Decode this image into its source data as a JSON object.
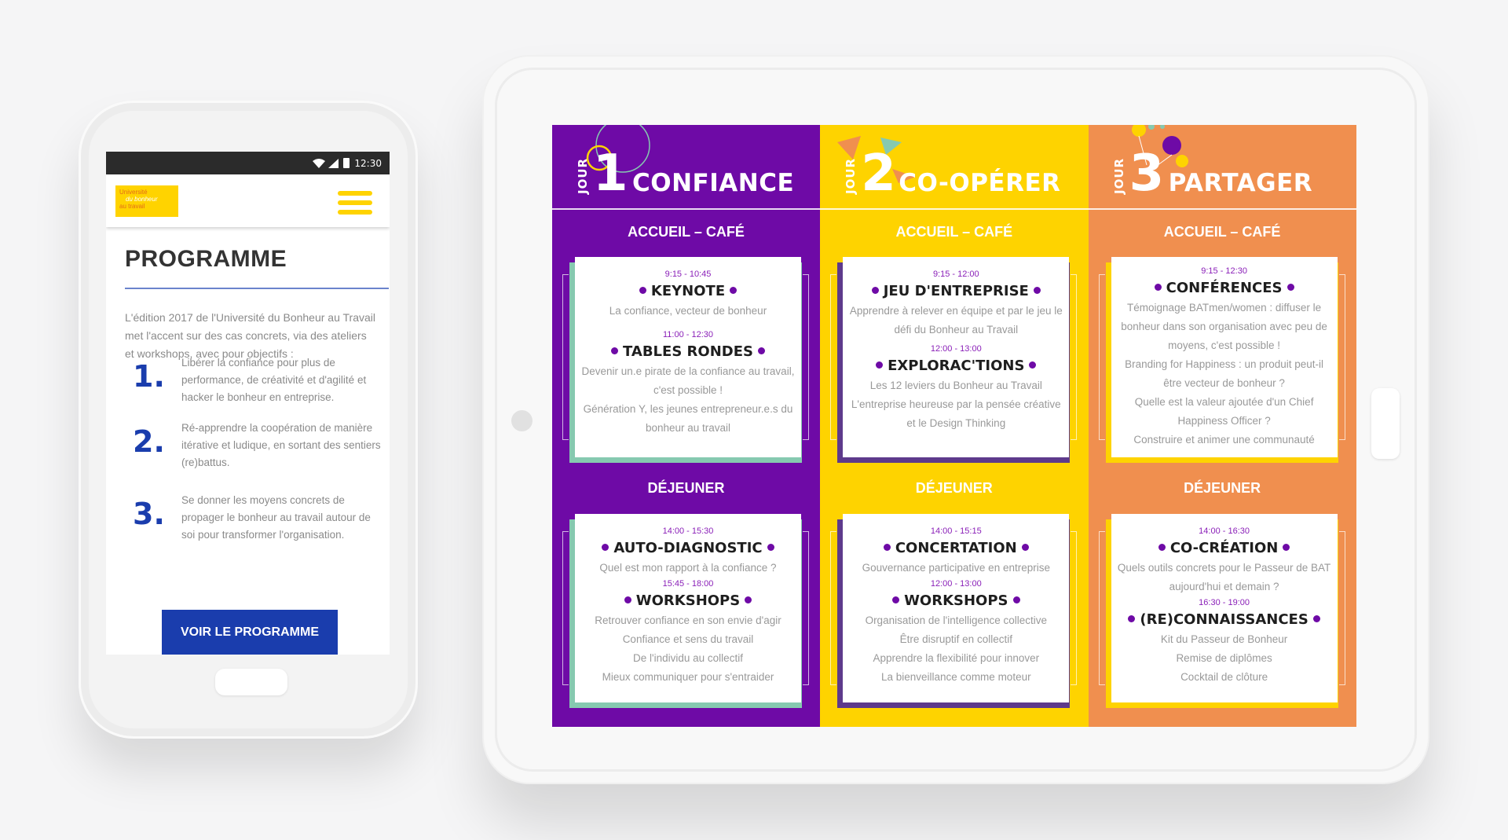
{
  "phone": {
    "status_time": "12:30",
    "logo_lines": [
      "Université",
      "du bonheur",
      "au travail"
    ],
    "title": "PROGRAMME",
    "intro": "L'édition 2017 de l'Université du Bonheur au Travail met l'accent sur des cas concrets, via des ateliers et workshops, avec pour objectifs :",
    "objectives": [
      {
        "num": "1.",
        "text": "Libérer la confiance pour plus de performance, de créativité et d'agilité et hacker le bonheur en entreprise."
      },
      {
        "num": "2.",
        "text": "Ré-apprendre la coopération de manière itérative et ludique, en sortant des sentiers (re)battus."
      },
      {
        "num": "3.",
        "text": "Se donner les moyens concrets de propager le bonheur au travail autour de soi pour transformer l'organisation."
      }
    ],
    "cta": "VOIR LE PROGRAMME"
  },
  "colors": {
    "purple": "#6e0aa6",
    "yellow": "#fed300",
    "orange": "#f08f4f",
    "blue": "#1a3dad",
    "mint": "#86c9b0"
  },
  "tablet": {
    "days": [
      {
        "jour": "JOUR",
        "num": "1",
        "name": "CONFIANCE",
        "welcome": "ACCUEIL – CAFÉ",
        "lunch": "DÉJEUNER",
        "morning": [
          {
            "time": "9:15 - 10:45",
            "title": "KEYNOTE",
            "lines": [
              "La confiance, vecteur de bonheur"
            ]
          },
          {
            "time": "11:00 - 12:30",
            "title": "TABLES RONDES",
            "lines": [
              "Devenir un.e pirate de la confiance au travail, c'est possible !",
              "Génération Y, les jeunes entrepreneur.e.s du bonheur au travail"
            ]
          }
        ],
        "afternoon": [
          {
            "time": "14:00 - 15:30",
            "title": "AUTO-DIAGNOSTIC",
            "lines": [
              "Quel est mon rapport à la confiance ?"
            ]
          },
          {
            "time": "15:45 - 18:00",
            "title": "WORKSHOPS",
            "lines": [
              "Retrouver confiance en son envie d'agir",
              "Confiance et sens du travail",
              "De l'individu au collectif",
              "Mieux communiquer pour s'entraider"
            ]
          }
        ]
      },
      {
        "jour": "JOUR",
        "num": "2",
        "name": "CO-OPÉRER",
        "welcome": "ACCUEIL – CAFÉ",
        "lunch": "DÉJEUNER",
        "morning": [
          {
            "time": "9:15 - 12:00",
            "title": "JEU D'ENTREPRISE",
            "lines": [
              "Apprendre à relever en équipe et par le jeu le défi du Bonheur au Travail"
            ]
          },
          {
            "time": "12:00 - 13:00",
            "title": "EXPLORAC'TIONS",
            "lines": [
              "Les 12 leviers du Bonheur au Travail",
              "L'entreprise heureuse par la pensée créative et le Design Thinking"
            ]
          }
        ],
        "afternoon": [
          {
            "time": "14:00 - 15:15",
            "title": "CONCERTATION",
            "lines": [
              "Gouvernance participative en entreprise"
            ]
          },
          {
            "time": "12:00 - 13:00",
            "title": "WORKSHOPS",
            "lines": [
              "Organisation de l'intelligence collective",
              "Être disruptif en collectif",
              "Apprendre la flexibilité pour innover",
              "La bienveillance comme moteur"
            ]
          }
        ]
      },
      {
        "jour": "JOUR",
        "num": "3",
        "name": "PARTAGER",
        "welcome": "ACCUEIL – CAFÉ",
        "lunch": "DÉJEUNER",
        "morning": [
          {
            "time": "9:15 - 12:30",
            "title": "CONFÉRENCES",
            "lines": [
              "Témoignage BATmen/women : diffuser le bonheur dans son organisation avec peu de moyens, c'est possible !",
              "Branding for Happiness : un produit peut-il être vecteur de bonheur ?",
              "Quelle est la valeur ajoutée d'un Chief Happiness Officer ?",
              "Construire et animer une communauté"
            ]
          }
        ],
        "afternoon": [
          {
            "time": "14:00 - 16:30",
            "title": "CO-CRÉATION",
            "lines": [
              "Quels outils concrets pour le Passeur de BAT aujourd'hui et demain ?"
            ]
          },
          {
            "time": "16:30 - 19:00",
            "title": "(RE)CONNAISSANCES",
            "lines": [
              "Kit du Passeur de Bonheur",
              "Remise de diplômes",
              "Cocktail de clôture"
            ]
          }
        ]
      }
    ]
  }
}
